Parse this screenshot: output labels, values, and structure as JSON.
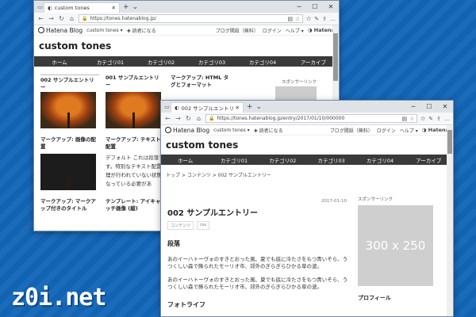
{
  "window1": {
    "tab_title": "custom tones",
    "url": "https://tones.hatenablog.jp/",
    "header": {
      "logo": "Hatena Blog",
      "blog_menu": "custom tones ▾",
      "subscribe": "✚ 読者になる",
      "links": [
        "ブログ開設（無料）",
        "ログイン",
        "ヘルプ ▾"
      ],
      "brand": "Hatena"
    },
    "blog_title": "custom tones",
    "nav": [
      "ホーム",
      "カテゴリ01",
      "カテゴリ02",
      "カテゴリ03",
      "カテゴリ04",
      "アーカイブ"
    ],
    "cards": [
      {
        "title": "002 サンプルエントリー",
        "thumb": "tree"
      },
      {
        "title": "001 サンプルエントリー",
        "thumb": "tree"
      },
      {
        "title": "マークアップ: HTML タグとフォーマット",
        "thumb": "none"
      },
      {
        "title": "マークアップ: 画像の配置",
        "thumb": "dark"
      },
      {
        "title": "マークアップ: テキスト配置",
        "thumb": "text"
      },
      {
        "title": "",
        "thumb": "none"
      },
      {
        "title": "マークアップ: マークアップ付きのタイトル",
        "thumb": "none"
      },
      {
        "title": "テンプレート: アイキャッチ画像 (縦)",
        "thumb": "none"
      }
    ],
    "card_text": "デフォルト これは段落です。特別なテキスト配置処理が行われていない状態になっている必要があ",
    "sponsor": "スポンサーリンク"
  },
  "window2": {
    "tab_title": "002 サンプルエントリー - c",
    "url": "https://tones.hatenablog.jp/entry/2017/01/10/000000",
    "header": {
      "logo": "Hatena Blog",
      "blog_menu": "custom tones ▾",
      "subscribe": "✚ 読者になる",
      "links": [
        "ブログ開設（無料）",
        "ログイン",
        "ヘルプ ▾"
      ],
      "brand": "Hatena"
    },
    "blog_title": "custom tones",
    "nav": [
      "ホーム",
      "カテゴリ01",
      "カテゴリ02",
      "カテゴリ03",
      "カテゴリ04",
      "アーカイブ"
    ],
    "breadcrumb": "トップ > コンテンツ > 002 サンプルエントリー",
    "post": {
      "date": "2017-01-10",
      "title": "002 サンプルエントリー",
      "tags": [
        "コンテンツ",
        "css"
      ],
      "h_paragraph": "段落",
      "paragraphs": [
        "あのイーハトーヴォのすきとおった風、夏でも底に冷たさをもつ青いそら、うつくしい森で飾られたモーリオ市、郊外のぎらぎらひかる草の波。",
        "あのイーハトーヴォのすきとおった風、夏でも底に冷たさをもつ青いそら、うつくしい森で飾られたモーリオ市、郊外のぎらぎらひかる草の波。"
      ],
      "h_next": "フォトライフ"
    },
    "sidebar": {
      "sponsor": "スポンサーリンク",
      "ad_text": "300 x 250",
      "profile": "プロフィール"
    }
  },
  "watermark": "z0i.net"
}
